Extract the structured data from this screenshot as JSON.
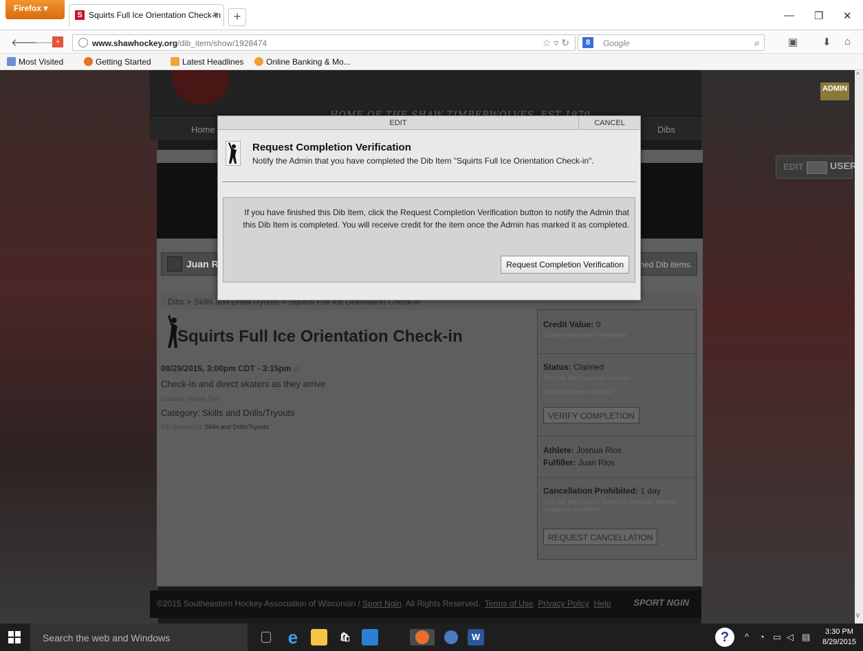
{
  "browser": {
    "menu_button": "Firefox",
    "tab_title": "Squirts Full Ice Orientation Check-in",
    "tab_favicon": "S",
    "url_domain": "www.shawhockey.org",
    "url_path": "/dib_item/show/1928474",
    "url_prefix": "",
    "search_placeholder": "Google",
    "search_engine": "8",
    "bookmarks": [
      "Most Visited",
      "Getting Started",
      "Latest Headlines",
      "Online Banking & Mo..."
    ]
  },
  "site": {
    "tagline": "HOME OF THE SHAW TIMBERWOLVES, EST 1970",
    "nav": [
      "Home",
      "Dibs"
    ],
    "admin_badge": "ADMIN",
    "mode_edit": "EDIT",
    "mode_user": "USER"
  },
  "page": {
    "user_name": "Juan R",
    "user_bar_right": "hed Dib items.",
    "breadcrumb": "Dibs > Skills and Drills/Tryouts > Squirts Full Ice Orientation Check-in",
    "item_title": "Squirts Full Ice Orientation Check-in",
    "time": "08/29/2015, 3:00pm CDT - 3:15pm",
    "description": "Check-in and direct skaters as they arrive",
    "location_label": "Location:",
    "location": "Wilson Park",
    "category_label": "Category:",
    "category": "Skills and Drills/Tryouts",
    "session_label": "Dib Session(s):",
    "session": "Skills and Drills/Tryouts"
  },
  "sidebar": {
    "credit_label": "Credit Value:",
    "credit_value": "0",
    "credit_note": "Credit issued upon completion.",
    "status_label": "Status:",
    "status_value": "Claimed",
    "status_note": "This Dib Item has been claimed.",
    "status_question": "Is this Dib Item complete?",
    "verify_button": "VERIFY COMPLETION",
    "athlete_label": "Athlete:",
    "athlete_value": "Joshua Rios",
    "fulfiller_label": "Fulfiller:",
    "fulfiller_value": "Juan Rios",
    "cancel_label": "Cancellation Prohibited:",
    "cancel_value": "1 day",
    "cancel_note": "This Dib Item can no longer be canceled without contacting the Admin.",
    "cancel_button": "REQUEST CANCELLATION"
  },
  "footer": {
    "copyright": "©2015 Southeastern Hockey Association of Wisconsin /",
    "sport_ngin": "Sport Ngin",
    "rights": ". All Rights Reserved.",
    "terms": "Terms of Use",
    "privacy": "Privacy Policy",
    "help": "Help",
    "logo": "SPORT NGIN"
  },
  "modal": {
    "tab_edit": "EDIT",
    "tab_cancel": "CANCEL",
    "title": "Request Completion Verification",
    "subtitle": "Notify the Admin that you have completed the Dib Item \"Squirts Full Ice Orientation Check-in\".",
    "body": "If you have finished this Dib Item, click the Request Completion Verification button to notify the Admin that this Dib Item is completed. You will receive credit for the item once the Admin has marked it as completed.",
    "button": "Request Completion Verification"
  },
  "taskbar": {
    "search_text": "Search the web and Windows",
    "time": "3:30 PM",
    "date": "8/29/2015"
  }
}
